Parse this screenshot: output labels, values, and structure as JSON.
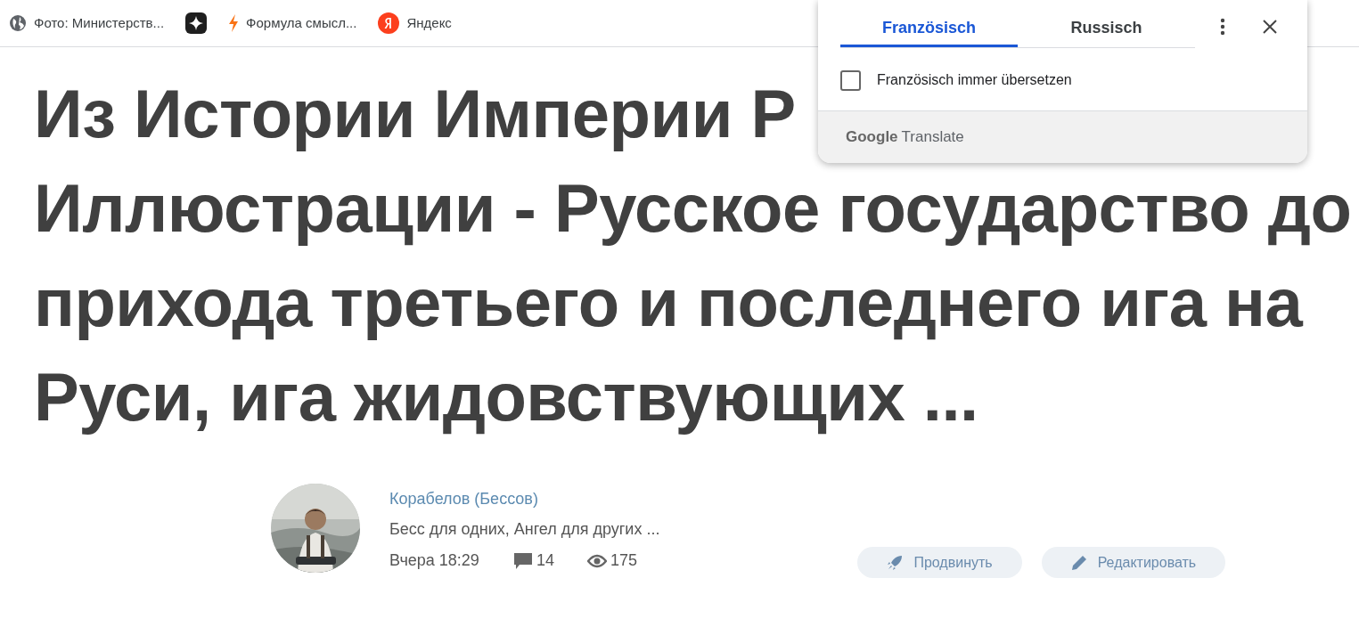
{
  "bookmarks": [
    {
      "kind": "globe",
      "label": "Фото: Министерств..."
    },
    {
      "kind": "star"
    },
    {
      "kind": "bolt",
      "label": "Формула смысл..."
    },
    {
      "kind": "yandex",
      "label": "Яндекс"
    }
  ],
  "headline": [
    "Из Истории Империи Р",
    "Иллюстрации - Русское государство до",
    "прихода третьего и последнего ига на",
    "Руси, ига жидовствующих ..."
  ],
  "author": {
    "name": "Корабелов (Бессов)",
    "bio": "Бесс для одних, Ангел для других ...",
    "date": "Вчера 18:29",
    "comments": "14",
    "views": "175"
  },
  "actions": [
    {
      "kind": "rocket",
      "label": "Продвинуть"
    },
    {
      "kind": "pencil",
      "label": "Редактировать"
    }
  ],
  "translate_popup": {
    "tabs": [
      {
        "label": "Französisch",
        "selected": true
      },
      {
        "label": "Russisch",
        "selected": false
      }
    ],
    "always_translate": {
      "label": "Französisch immer übersetzen",
      "checked": false
    },
    "footer_brand": "Google",
    "footer_product": "Translate"
  }
}
